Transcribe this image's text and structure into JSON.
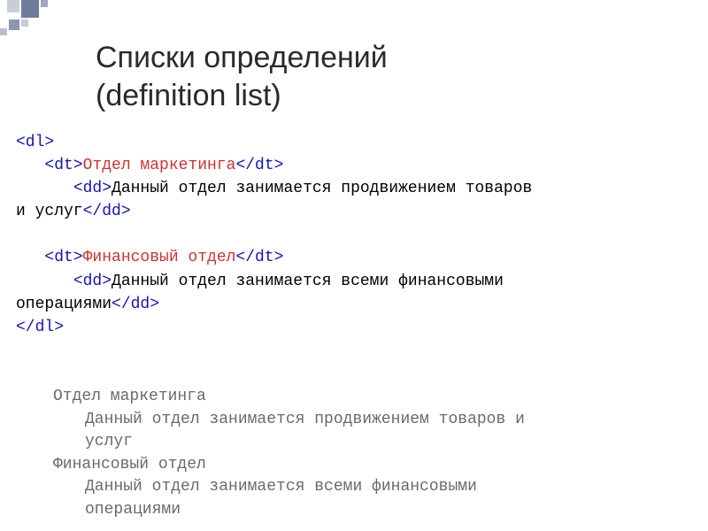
{
  "title_line1": "Списки определений",
  "title_line2": "(definition list)",
  "code": {
    "dl_open": "<dl>",
    "dl_close": "</dl>",
    "dt_open": "<dt>",
    "dt_close": "</dt>",
    "dd_open": "<dd>",
    "dd_close": "</dd>",
    "dt1_text": "Отдел маркетинга",
    "dd1_text_a": "Данный отдел занимается продвижением товаров",
    "dd1_text_b": "и услуг",
    "dt2_text": "Финансовый отдел",
    "dd2_text_a": "Данный отдел занимается всеми финансовыми",
    "dd2_text_b": "операциями"
  },
  "output": {
    "dt1": "Отдел маркетинга",
    "dd1_a": "Данный отдел занимается продвижением товаров и",
    "dd1_b": "услуг",
    "dt2": "Финансовый отдел",
    "dd2_a": "Данный отдел занимается всеми финансовыми",
    "dd2_b": "операциями"
  }
}
